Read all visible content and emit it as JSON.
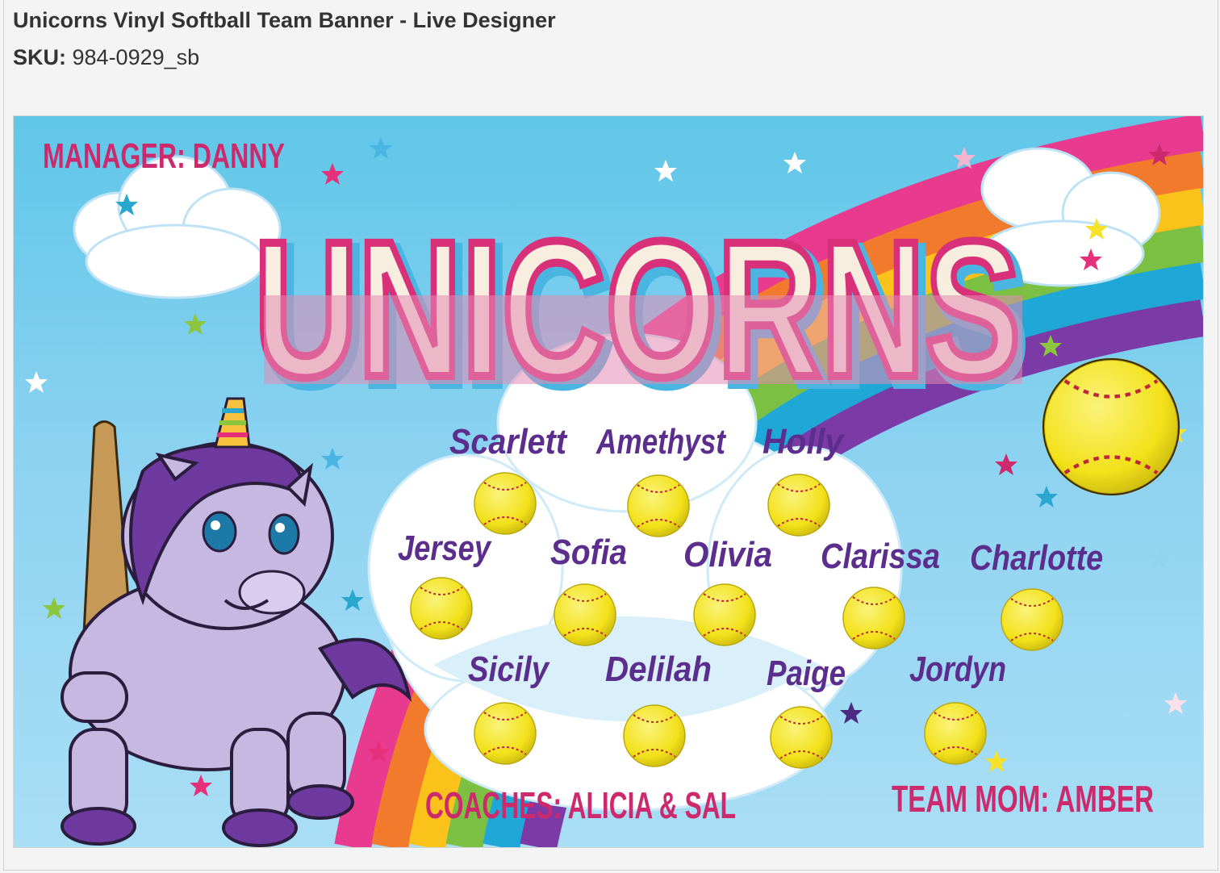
{
  "page": {
    "title": "Unicorns Vinyl Softball Team Banner - Live Designer",
    "sku_label": "SKU:",
    "sku_value": "984-0929_sb"
  },
  "banner": {
    "manager": "MANAGER: DANNY",
    "team_name": "UNICORNS",
    "coaches": "COACHES: ALICIA & SAL",
    "team_mom": "TEAM MOM: AMBER",
    "players": [
      "Scarlett",
      "Amethyst",
      "Holly",
      "Jersey",
      "Sofia",
      "Olivia",
      "Clarissa",
      "Charlotte",
      "Sicily",
      "Delilah",
      "Paige",
      "Jordyn"
    ],
    "colors": {
      "accent_pink": "#cc2a6c",
      "name_purple": "#5b2d8c",
      "sky": "#7ec8ec",
      "ball_yellow": "#f4e61c"
    }
  }
}
